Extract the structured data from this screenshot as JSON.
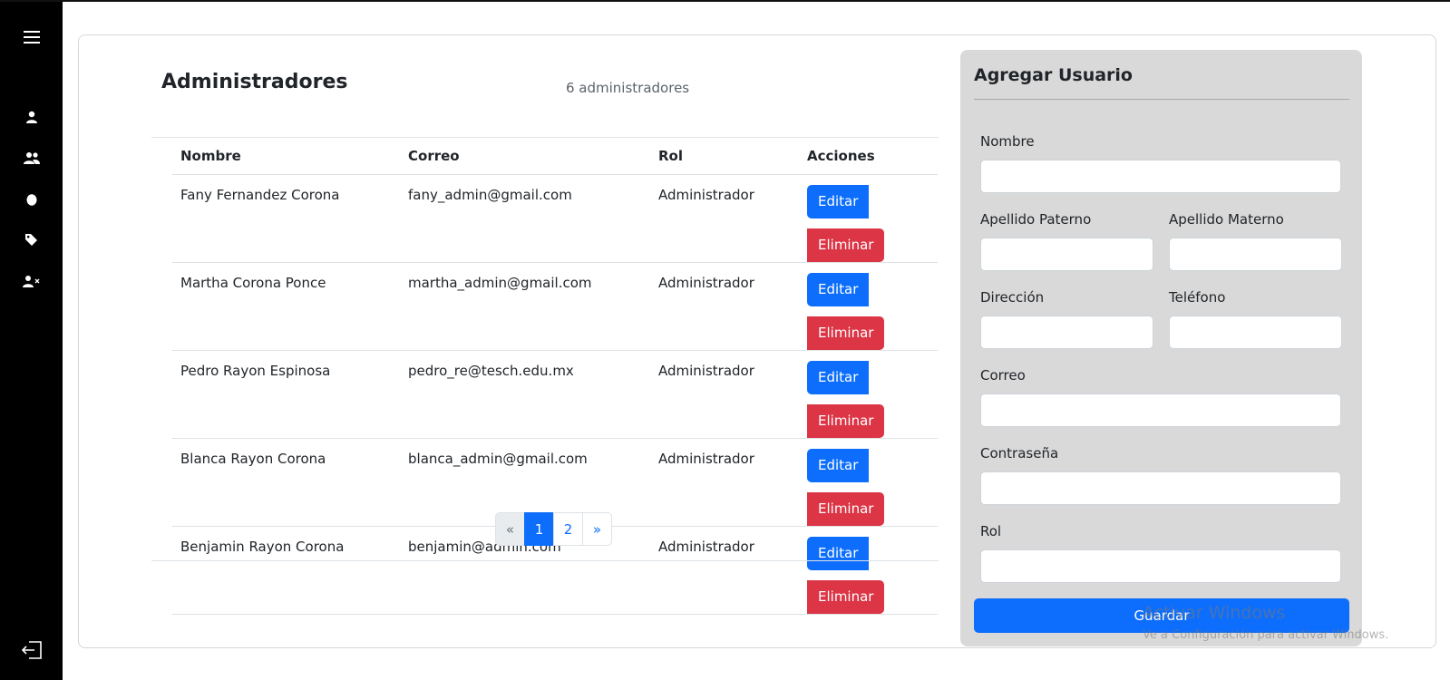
{
  "sidebar": {
    "icons": [
      "menu-icon",
      "user-icon",
      "users-icon",
      "egg-icon",
      "tag-icon",
      "user-remove-icon",
      "logout-icon"
    ]
  },
  "header": {
    "title": "Administradores",
    "count": "6 administradores"
  },
  "table": {
    "columns": [
      "Nombre",
      "Correo",
      "Rol",
      "Acciones"
    ],
    "rows": [
      {
        "name": "Fany Fernandez Corona",
        "email": "fany_admin@gmail.com",
        "role": "Administrador"
      },
      {
        "name": "Martha Corona Ponce",
        "email": "martha_admin@gmail.com",
        "role": "Administrador"
      },
      {
        "name": "Pedro Rayon Espinosa",
        "email": "pedro_re@tesch.edu.mx",
        "role": "Administrador"
      },
      {
        "name": "Blanca Rayon Corona",
        "email": "blanca_admin@gmail.com",
        "role": "Administrador"
      },
      {
        "name": "Benjamin Rayon Corona",
        "email": "benjamin@admin.com",
        "role": "Administrador"
      }
    ],
    "edit_label": "Editar",
    "delete_label": "Eliminar"
  },
  "pagination": {
    "prev": "«",
    "pages": [
      "1",
      "2"
    ],
    "active": "1",
    "next": "»"
  },
  "form": {
    "title": "Agregar Usuario",
    "nombre": "Nombre",
    "apellido_paterno": "Apellido Paterno",
    "apellido_materno": "Apellido Materno",
    "direccion": "Dirección",
    "telefono": "Teléfono",
    "correo": "Correo",
    "contrasena": "Contraseña",
    "rol": "Rol",
    "save_label": "Guardar"
  },
  "watermark": {
    "line1": "Activar Windows",
    "line2": "Ve a Configuración para activar Windows."
  },
  "colors": {
    "primary": "#0d6efd",
    "danger": "#dc3545",
    "sidebar": "#000000",
    "panel": "#d9d9d9"
  }
}
